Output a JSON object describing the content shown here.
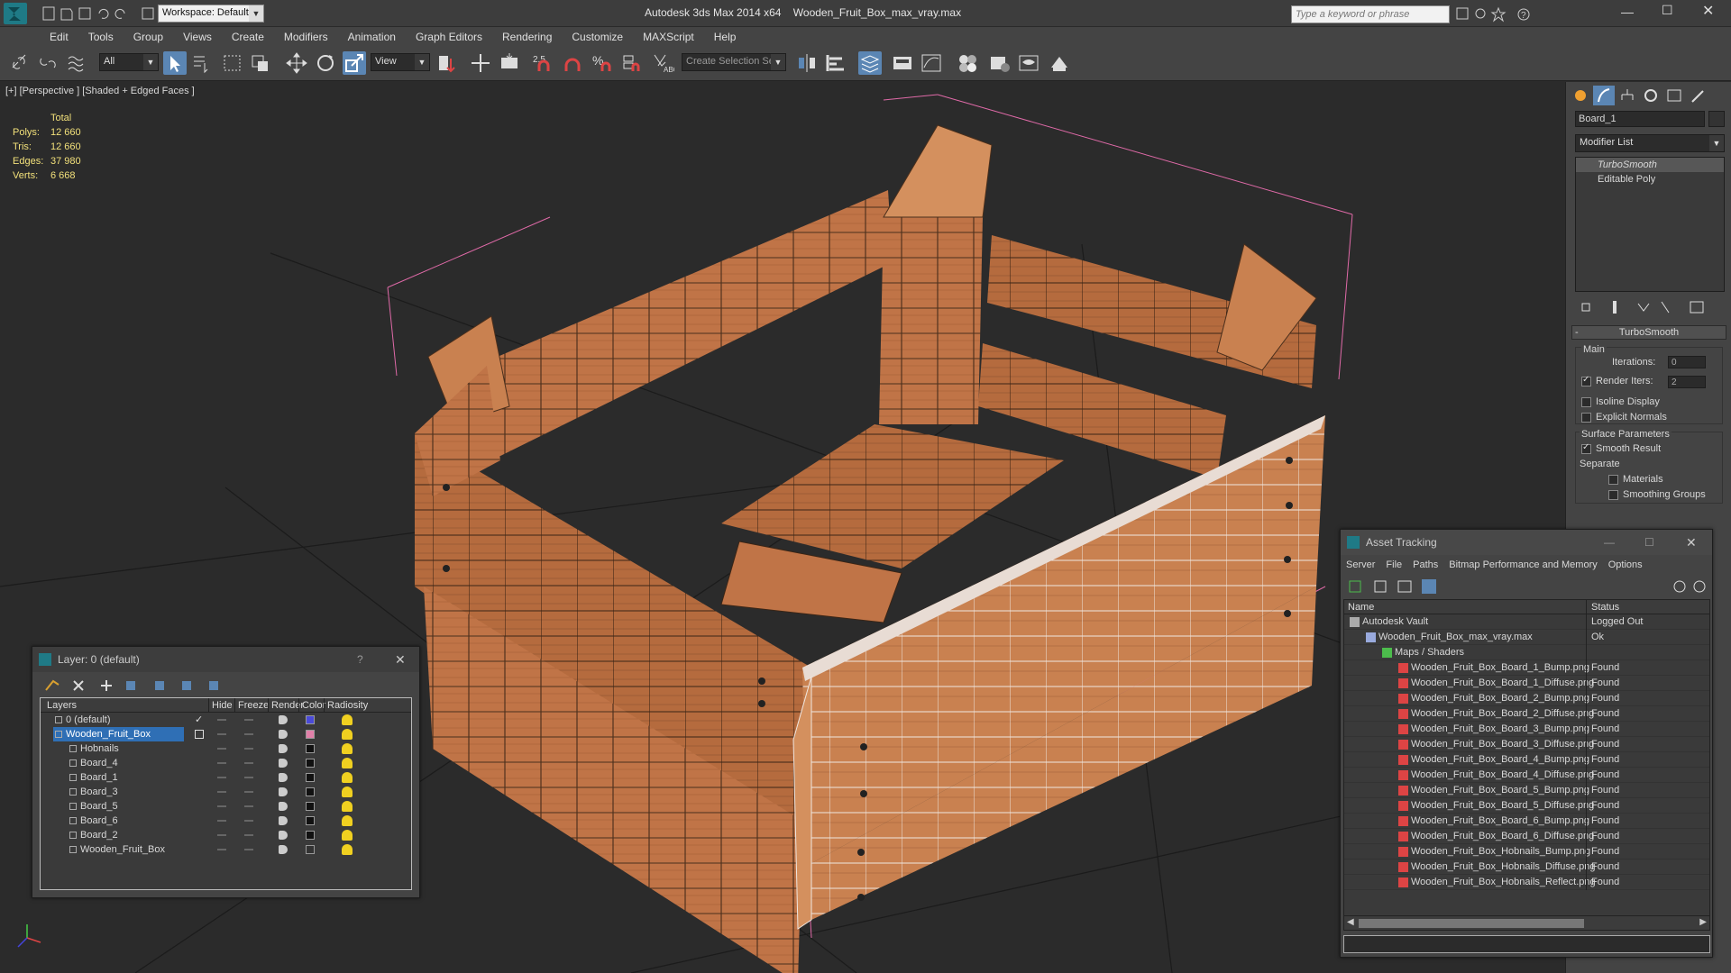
{
  "titlebar": {
    "app_title": "Autodesk 3ds Max  2014 x64",
    "file_title": "Wooden_Fruit_Box_max_vray.max",
    "workspace": "Workspace: Default",
    "search_placeholder": "Type a keyword or phrase"
  },
  "menu": [
    "Edit",
    "Tools",
    "Group",
    "Views",
    "Create",
    "Modifiers",
    "Animation",
    "Graph Editors",
    "Rendering",
    "Customize",
    "MAXScript",
    "Help"
  ],
  "toolbar": {
    "filter_value": "All",
    "refcoord_value": "View",
    "selection_set_placeholder": "Create Selection Se",
    "snap_label": "2.5"
  },
  "viewport": {
    "label": "[+] [Perspective ] [Shaded + Edged Faces ]",
    "stats": {
      "header": "Total",
      "rows": [
        {
          "label": "Polys:",
          "value": "12 660"
        },
        {
          "label": "Tris:",
          "value": "12 660"
        },
        {
          "label": "Edges:",
          "value": "37 980"
        },
        {
          "label": "Verts:",
          "value": "6 668"
        }
      ]
    }
  },
  "command_panel": {
    "object_name": "Board_1",
    "modifier_list": "Modifier List",
    "stack": [
      "TurboSmooth",
      "Editable Poly"
    ],
    "rollout_title": "TurboSmooth",
    "main_label": "Main",
    "iterations_label": "Iterations:",
    "iterations_value": "0",
    "render_iters_label": "Render Iters:",
    "render_iters_value": "2",
    "isoline_label": "Isoline Display",
    "explicit_normals_label": "Explicit Normals",
    "surface_params_label": "Surface Parameters",
    "smooth_result_label": "Smooth Result",
    "separate_label": "Separate",
    "materials_label": "Materials",
    "smoothing_groups_label": "Smoothing Groups"
  },
  "layer_window": {
    "title": "Layer: 0 (default)",
    "help": "?",
    "columns": [
      "Layers",
      "Hide",
      "Freeze",
      "Render",
      "Color",
      "Radiosity"
    ],
    "rows": [
      {
        "name": "0 (default)",
        "indent": 1,
        "color": "#4a4ad8",
        "checked": true,
        "selected": false
      },
      {
        "name": "Wooden_Fruit_Box",
        "indent": 1,
        "color": "#e07fa8",
        "checked": false,
        "selected": true
      },
      {
        "name": "Hobnails",
        "indent": 2,
        "color": "#111111",
        "checked": false,
        "selected": false
      },
      {
        "name": "Board_4",
        "indent": 2,
        "color": "#111111",
        "checked": false,
        "selected": false
      },
      {
        "name": "Board_1",
        "indent": 2,
        "color": "#111111",
        "checked": false,
        "selected": false
      },
      {
        "name": "Board_3",
        "indent": 2,
        "color": "#111111",
        "checked": false,
        "selected": false
      },
      {
        "name": "Board_5",
        "indent": 2,
        "color": "#111111",
        "checked": false,
        "selected": false
      },
      {
        "name": "Board_6",
        "indent": 2,
        "color": "#111111",
        "checked": false,
        "selected": false
      },
      {
        "name": "Board_2",
        "indent": 2,
        "color": "#111111",
        "checked": false,
        "selected": false
      },
      {
        "name": "Wooden_Fruit_Box",
        "indent": 2,
        "color": "#333333",
        "checked": false,
        "selected": false
      }
    ]
  },
  "asset_window": {
    "title": "Asset Tracking",
    "menu": [
      "Server",
      "File",
      "Paths",
      "Bitmap Performance and Memory",
      "Options"
    ],
    "columns": [
      "Name",
      "Status"
    ],
    "rows": [
      {
        "name": "Autodesk Vault",
        "status": "Logged Out",
        "indent": 0,
        "icon": "vault"
      },
      {
        "name": "Wooden_Fruit_Box_max_vray.max",
        "status": "Ok",
        "indent": 1,
        "icon": "max"
      },
      {
        "name": "Maps / Shaders",
        "status": "",
        "indent": 2,
        "icon": "maps"
      },
      {
        "name": "Wooden_Fruit_Box_Board_1_Bump.png",
        "status": "Found",
        "indent": 3,
        "icon": "png"
      },
      {
        "name": "Wooden_Fruit_Box_Board_1_Diffuse.png",
        "status": "Found",
        "indent": 3,
        "icon": "png"
      },
      {
        "name": "Wooden_Fruit_Box_Board_2_Bump.png",
        "status": "Found",
        "indent": 3,
        "icon": "png"
      },
      {
        "name": "Wooden_Fruit_Box_Board_2_Diffuse.png",
        "status": "Found",
        "indent": 3,
        "icon": "png"
      },
      {
        "name": "Wooden_Fruit_Box_Board_3_Bump.png",
        "status": "Found",
        "indent": 3,
        "icon": "png"
      },
      {
        "name": "Wooden_Fruit_Box_Board_3_Diffuse.png",
        "status": "Found",
        "indent": 3,
        "icon": "png"
      },
      {
        "name": "Wooden_Fruit_Box_Board_4_Bump.png",
        "status": "Found",
        "indent": 3,
        "icon": "png"
      },
      {
        "name": "Wooden_Fruit_Box_Board_4_Diffuse.png",
        "status": "Found",
        "indent": 3,
        "icon": "png"
      },
      {
        "name": "Wooden_Fruit_Box_Board_5_Bump.png",
        "status": "Found",
        "indent": 3,
        "icon": "png"
      },
      {
        "name": "Wooden_Fruit_Box_Board_5_Diffuse.png",
        "status": "Found",
        "indent": 3,
        "icon": "png"
      },
      {
        "name": "Wooden_Fruit_Box_Board_6_Bump.png",
        "status": "Found",
        "indent": 3,
        "icon": "png"
      },
      {
        "name": "Wooden_Fruit_Box_Board_6_Diffuse.png",
        "status": "Found",
        "indent": 3,
        "icon": "png"
      },
      {
        "name": "Wooden_Fruit_Box_Hobnails_Bump.png",
        "status": "Found",
        "indent": 3,
        "icon": "png"
      },
      {
        "name": "Wooden_Fruit_Box_Hobnails_Diffuse.png",
        "status": "Found",
        "indent": 3,
        "icon": "png"
      },
      {
        "name": "Wooden_Fruit_Box_Hobnails_Reflect.png",
        "status": "Found",
        "indent": 3,
        "icon": "png"
      }
    ]
  },
  "colors": {
    "accent": "#5b86b4",
    "stats": "#f2e07a",
    "selection": "#e06aa8",
    "wood": "#c47a4e"
  }
}
